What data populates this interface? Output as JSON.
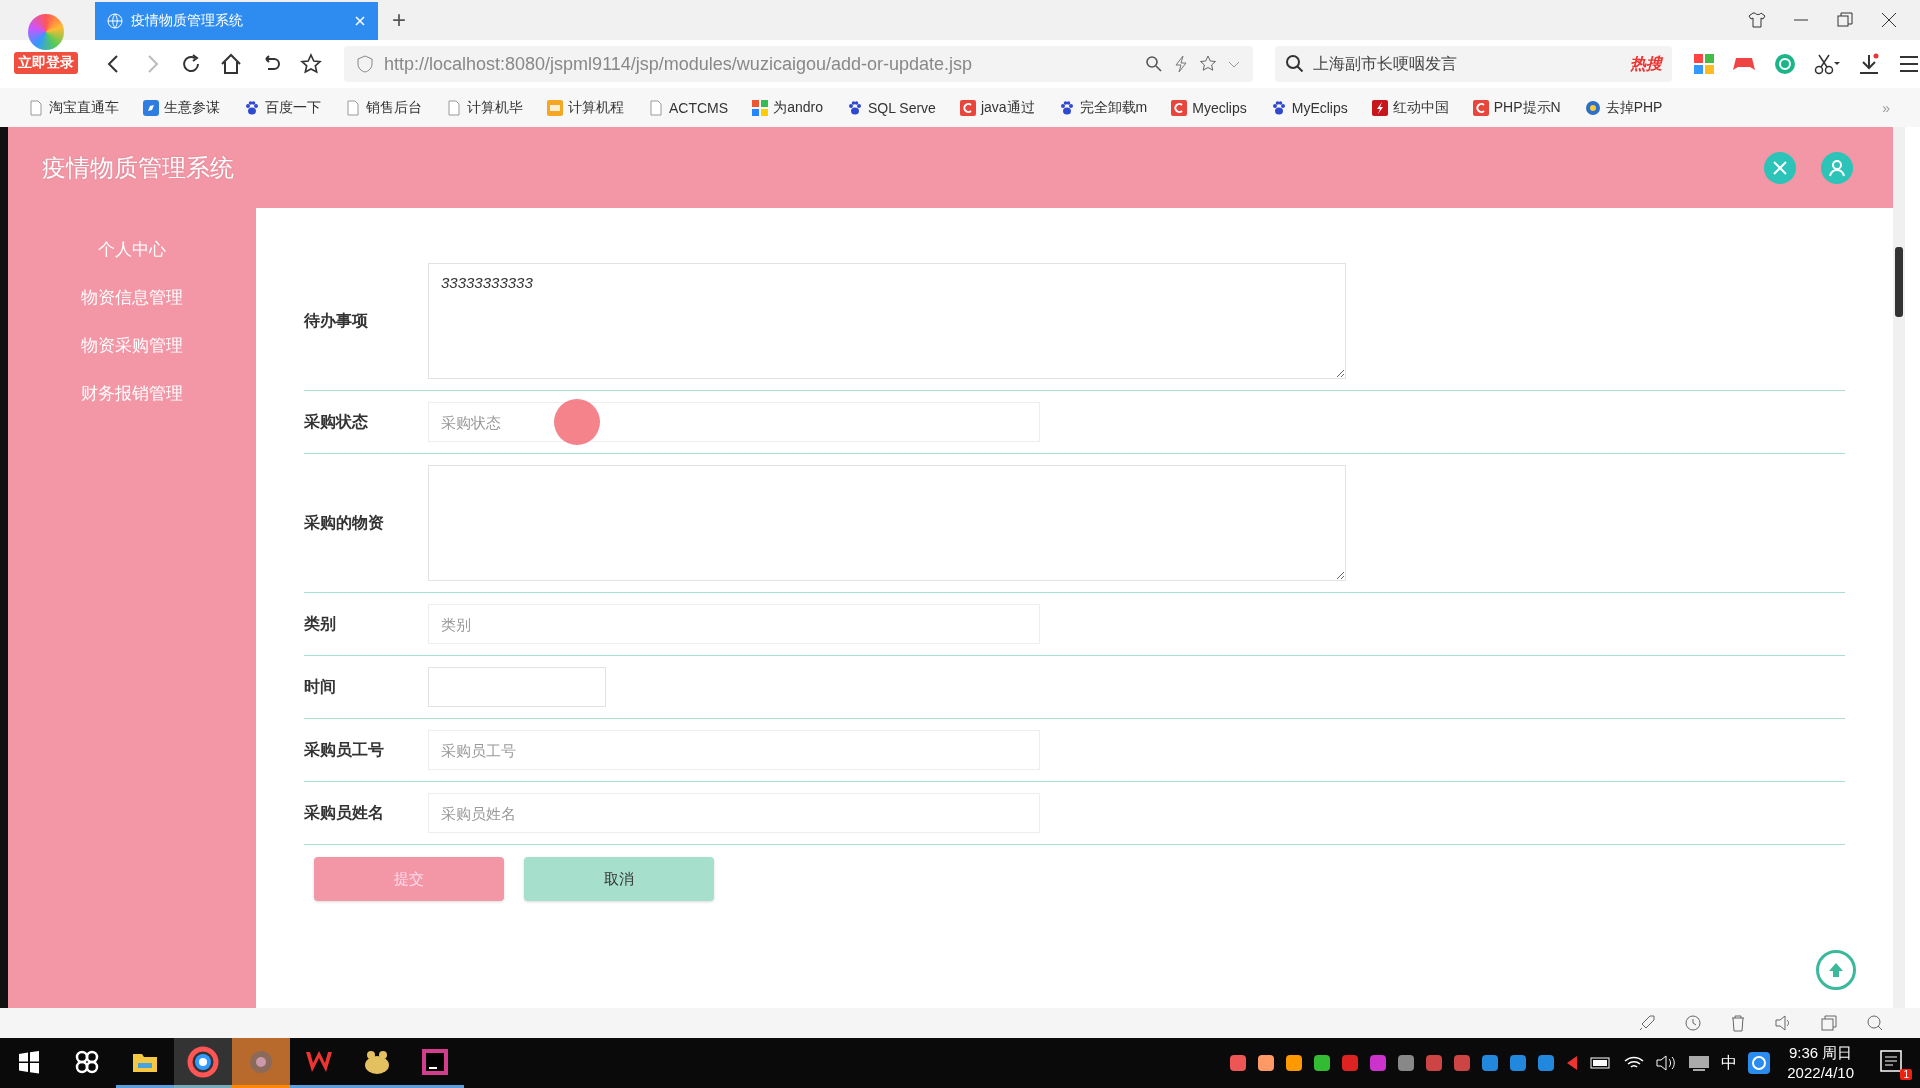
{
  "browser": {
    "login_badge": "立即登录",
    "tab_title": "疫情物质管理系统",
    "new_tab": "+",
    "url": "http://localhost:8080/jspml9114/jsp/modules/wuzicaigou/add-or-update.jsp",
    "search_text": "上海副市长哽咽发言",
    "hot_label": "热搜",
    "bookmarks": [
      {
        "label": "淘宝直通车",
        "kind": "page"
      },
      {
        "label": "生意参谋",
        "kind": "blue"
      },
      {
        "label": "百度一下",
        "kind": "paw"
      },
      {
        "label": "销售后台",
        "kind": "page"
      },
      {
        "label": "计算机毕",
        "kind": "page"
      },
      {
        "label": "计算机程",
        "kind": "orange"
      },
      {
        "label": "ACTCMS",
        "kind": "page"
      },
      {
        "label": "为andro",
        "kind": "colorful"
      },
      {
        "label": "SQL Serve",
        "kind": "paw"
      },
      {
        "label": "java通过",
        "kind": "red"
      },
      {
        "label": "完全卸载m",
        "kind": "paw"
      },
      {
        "label": "Myeclips",
        "kind": "red"
      },
      {
        "label": "MyEclips",
        "kind": "paw"
      },
      {
        "label": "红动中国",
        "kind": "flash"
      },
      {
        "label": "PHP提示N",
        "kind": "red"
      },
      {
        "label": "去掉PHP",
        "kind": "circle"
      }
    ],
    "more": "»"
  },
  "app": {
    "title": "疫情物质管理系统",
    "menu": [
      {
        "label": "个人中心"
      },
      {
        "label": "物资信息管理"
      },
      {
        "label": "物资采购管理"
      },
      {
        "label": "财务报销管理"
      }
    ],
    "fields": [
      {
        "kind": "textarea",
        "label": "待办事项",
        "value": "33333333333"
      },
      {
        "kind": "input",
        "label": "采购状态",
        "placeholder": "采购状态"
      },
      {
        "kind": "textarea",
        "label": "采购的物资"
      },
      {
        "kind": "input",
        "label": "类别",
        "placeholder": "类别"
      },
      {
        "kind": "date",
        "label": "时间"
      },
      {
        "kind": "input",
        "label": "采购员工号",
        "placeholder": "采购员工号"
      },
      {
        "kind": "input",
        "label": "采购员姓名",
        "placeholder": "采购员姓名"
      }
    ],
    "buttons": [
      {
        "label": "提交",
        "kind": "primary"
      },
      {
        "label": "取消",
        "kind": "cancel"
      }
    ]
  },
  "taskbar": {
    "time": "9:36 周日",
    "date": "2022/4/10",
    "ime": "中",
    "notifications": "1"
  }
}
